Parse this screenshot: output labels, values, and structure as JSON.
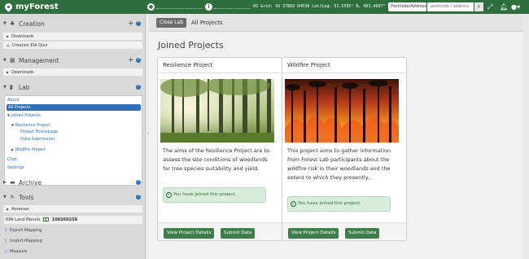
{
  "app": {
    "name": "myForest",
    "coords_text": "OS Grid: SU 37869 84538  Lat/Lng: 51.5585° N, 001.4667° W",
    "postcode_select": "Postcode/Address",
    "postcode_placeholder": "postcode / address"
  },
  "colors": {
    "brand": "#2f6e3f",
    "link": "#2e6fb5",
    "joined_bg": "#d9eddb"
  },
  "sidebar": {
    "creation": {
      "title": "Creation",
      "items": [
        "Downloads",
        "Creation EIA Quiz"
      ]
    },
    "management": {
      "title": "Management",
      "items": [
        "Downloads"
      ]
    },
    "lab": {
      "title": "Lab",
      "items": [
        "About",
        "All Projects",
        "Joined Projects",
        "Resilience Project",
        "Project Homepage",
        "Data Submission",
        "Wildfire Project",
        "Chat",
        "Settings"
      ]
    },
    "archive": {
      "title": "Archive"
    },
    "tools": {
      "title": "Tools",
      "assessor": "Assessor",
      "rpa_label": "RPA Land Parcels",
      "rpa_id": "106269258",
      "items": [
        "Export Mapping",
        "Import Mapping",
        "Measure"
      ]
    }
  },
  "main": {
    "close_lab": "Close Lab",
    "breadcrumb": "All Projects",
    "page_title": "Joined Projects",
    "cards": [
      {
        "title": "Resilience Project",
        "description": "The aims of the Resilience Project are to assess the site conditions of woodlands for tree species suitability and yield.",
        "joined_text": "You have joined this project.",
        "details_button": "View Project Details",
        "submit_button": "Submit Data"
      },
      {
        "title": "Wildfire Project",
        "description": "This project aims to gather information from Forest Lab participants about the wildfire risk in their woodlands and the extent to which they presently...",
        "joined_text": "You have joined this project.",
        "details_button": "View Project Details",
        "submit_button": "Submit Data"
      }
    ]
  }
}
